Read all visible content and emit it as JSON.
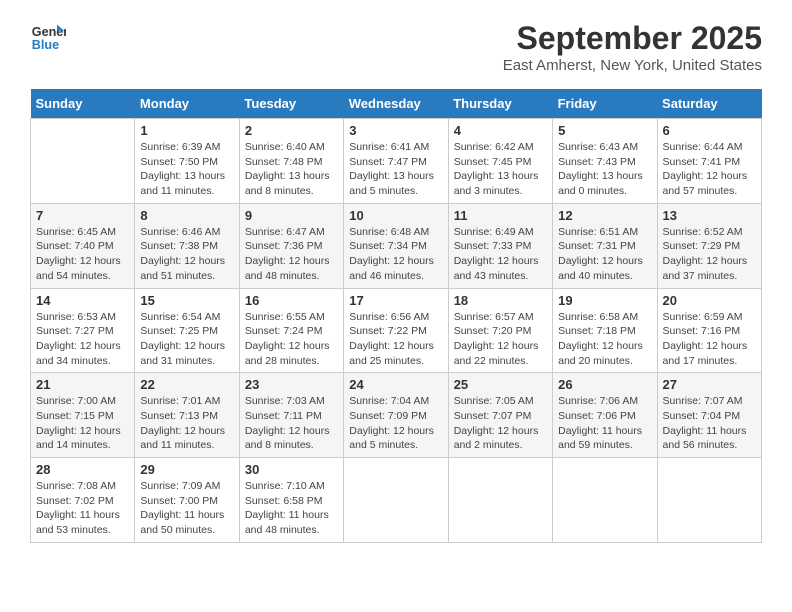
{
  "header": {
    "logo_line1": "General",
    "logo_line2": "Blue",
    "month": "September 2025",
    "location": "East Amherst, New York, United States"
  },
  "days_of_week": [
    "Sunday",
    "Monday",
    "Tuesday",
    "Wednesday",
    "Thursday",
    "Friday",
    "Saturday"
  ],
  "weeks": [
    [
      {
        "day": "",
        "empty": true
      },
      {
        "day": "1",
        "sunrise": "Sunrise: 6:39 AM",
        "sunset": "Sunset: 7:50 PM",
        "daylight": "Daylight: 13 hours and 11 minutes."
      },
      {
        "day": "2",
        "sunrise": "Sunrise: 6:40 AM",
        "sunset": "Sunset: 7:48 PM",
        "daylight": "Daylight: 13 hours and 8 minutes."
      },
      {
        "day": "3",
        "sunrise": "Sunrise: 6:41 AM",
        "sunset": "Sunset: 7:47 PM",
        "daylight": "Daylight: 13 hours and 5 minutes."
      },
      {
        "day": "4",
        "sunrise": "Sunrise: 6:42 AM",
        "sunset": "Sunset: 7:45 PM",
        "daylight": "Daylight: 13 hours and 3 minutes."
      },
      {
        "day": "5",
        "sunrise": "Sunrise: 6:43 AM",
        "sunset": "Sunset: 7:43 PM",
        "daylight": "Daylight: 13 hours and 0 minutes."
      },
      {
        "day": "6",
        "sunrise": "Sunrise: 6:44 AM",
        "sunset": "Sunset: 7:41 PM",
        "daylight": "Daylight: 12 hours and 57 minutes."
      }
    ],
    [
      {
        "day": "7",
        "sunrise": "Sunrise: 6:45 AM",
        "sunset": "Sunset: 7:40 PM",
        "daylight": "Daylight: 12 hours and 54 minutes."
      },
      {
        "day": "8",
        "sunrise": "Sunrise: 6:46 AM",
        "sunset": "Sunset: 7:38 PM",
        "daylight": "Daylight: 12 hours and 51 minutes."
      },
      {
        "day": "9",
        "sunrise": "Sunrise: 6:47 AM",
        "sunset": "Sunset: 7:36 PM",
        "daylight": "Daylight: 12 hours and 48 minutes."
      },
      {
        "day": "10",
        "sunrise": "Sunrise: 6:48 AM",
        "sunset": "Sunset: 7:34 PM",
        "daylight": "Daylight: 12 hours and 46 minutes."
      },
      {
        "day": "11",
        "sunrise": "Sunrise: 6:49 AM",
        "sunset": "Sunset: 7:33 PM",
        "daylight": "Daylight: 12 hours and 43 minutes."
      },
      {
        "day": "12",
        "sunrise": "Sunrise: 6:51 AM",
        "sunset": "Sunset: 7:31 PM",
        "daylight": "Daylight: 12 hours and 40 minutes."
      },
      {
        "day": "13",
        "sunrise": "Sunrise: 6:52 AM",
        "sunset": "Sunset: 7:29 PM",
        "daylight": "Daylight: 12 hours and 37 minutes."
      }
    ],
    [
      {
        "day": "14",
        "sunrise": "Sunrise: 6:53 AM",
        "sunset": "Sunset: 7:27 PM",
        "daylight": "Daylight: 12 hours and 34 minutes."
      },
      {
        "day": "15",
        "sunrise": "Sunrise: 6:54 AM",
        "sunset": "Sunset: 7:25 PM",
        "daylight": "Daylight: 12 hours and 31 minutes."
      },
      {
        "day": "16",
        "sunrise": "Sunrise: 6:55 AM",
        "sunset": "Sunset: 7:24 PM",
        "daylight": "Daylight: 12 hours and 28 minutes."
      },
      {
        "day": "17",
        "sunrise": "Sunrise: 6:56 AM",
        "sunset": "Sunset: 7:22 PM",
        "daylight": "Daylight: 12 hours and 25 minutes."
      },
      {
        "day": "18",
        "sunrise": "Sunrise: 6:57 AM",
        "sunset": "Sunset: 7:20 PM",
        "daylight": "Daylight: 12 hours and 22 minutes."
      },
      {
        "day": "19",
        "sunrise": "Sunrise: 6:58 AM",
        "sunset": "Sunset: 7:18 PM",
        "daylight": "Daylight: 12 hours and 20 minutes."
      },
      {
        "day": "20",
        "sunrise": "Sunrise: 6:59 AM",
        "sunset": "Sunset: 7:16 PM",
        "daylight": "Daylight: 12 hours and 17 minutes."
      }
    ],
    [
      {
        "day": "21",
        "sunrise": "Sunrise: 7:00 AM",
        "sunset": "Sunset: 7:15 PM",
        "daylight": "Daylight: 12 hours and 14 minutes."
      },
      {
        "day": "22",
        "sunrise": "Sunrise: 7:01 AM",
        "sunset": "Sunset: 7:13 PM",
        "daylight": "Daylight: 12 hours and 11 minutes."
      },
      {
        "day": "23",
        "sunrise": "Sunrise: 7:03 AM",
        "sunset": "Sunset: 7:11 PM",
        "daylight": "Daylight: 12 hours and 8 minutes."
      },
      {
        "day": "24",
        "sunrise": "Sunrise: 7:04 AM",
        "sunset": "Sunset: 7:09 PM",
        "daylight": "Daylight: 12 hours and 5 minutes."
      },
      {
        "day": "25",
        "sunrise": "Sunrise: 7:05 AM",
        "sunset": "Sunset: 7:07 PM",
        "daylight": "Daylight: 12 hours and 2 minutes."
      },
      {
        "day": "26",
        "sunrise": "Sunrise: 7:06 AM",
        "sunset": "Sunset: 7:06 PM",
        "daylight": "Daylight: 11 hours and 59 minutes."
      },
      {
        "day": "27",
        "sunrise": "Sunrise: 7:07 AM",
        "sunset": "Sunset: 7:04 PM",
        "daylight": "Daylight: 11 hours and 56 minutes."
      }
    ],
    [
      {
        "day": "28",
        "sunrise": "Sunrise: 7:08 AM",
        "sunset": "Sunset: 7:02 PM",
        "daylight": "Daylight: 11 hours and 53 minutes."
      },
      {
        "day": "29",
        "sunrise": "Sunrise: 7:09 AM",
        "sunset": "Sunset: 7:00 PM",
        "daylight": "Daylight: 11 hours and 50 minutes."
      },
      {
        "day": "30",
        "sunrise": "Sunrise: 7:10 AM",
        "sunset": "Sunset: 6:58 PM",
        "daylight": "Daylight: 11 hours and 48 minutes."
      },
      {
        "day": "",
        "empty": true
      },
      {
        "day": "",
        "empty": true
      },
      {
        "day": "",
        "empty": true
      },
      {
        "day": "",
        "empty": true
      }
    ]
  ]
}
